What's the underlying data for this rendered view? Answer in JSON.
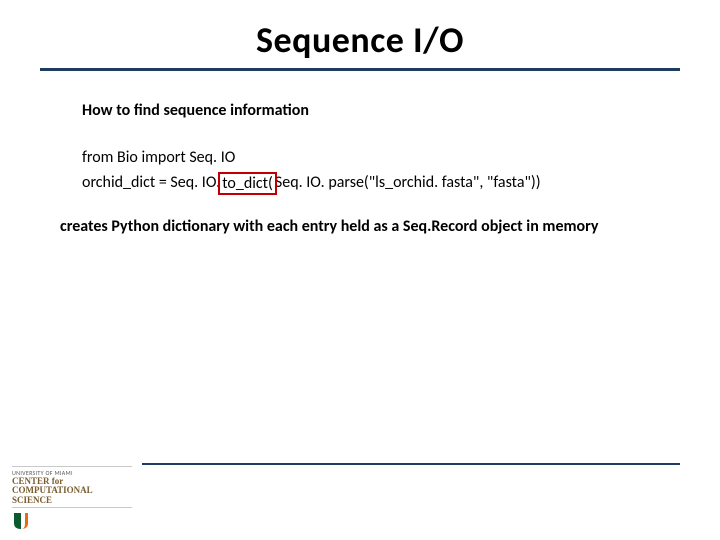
{
  "title": "Sequence I/O",
  "subheading": "How to find sequence information",
  "code": {
    "line1": "from Bio import Seq. IO",
    "line2_pre": "orchid_dict = Seq. IO.",
    "line2_box": "to_dict(",
    "line2_post": "Seq. IO. parse(\"ls_orchid. fasta\", \"fasta\"))"
  },
  "description": "creates Python dictionary with each entry held as a Seq.Record object in memory",
  "footer": {
    "university": "UNIVERSITY OF MIAMI",
    "center_line1": "CENTER for",
    "center_line2": "COMPUTATIONAL",
    "center_line3": "SCIENCE"
  }
}
